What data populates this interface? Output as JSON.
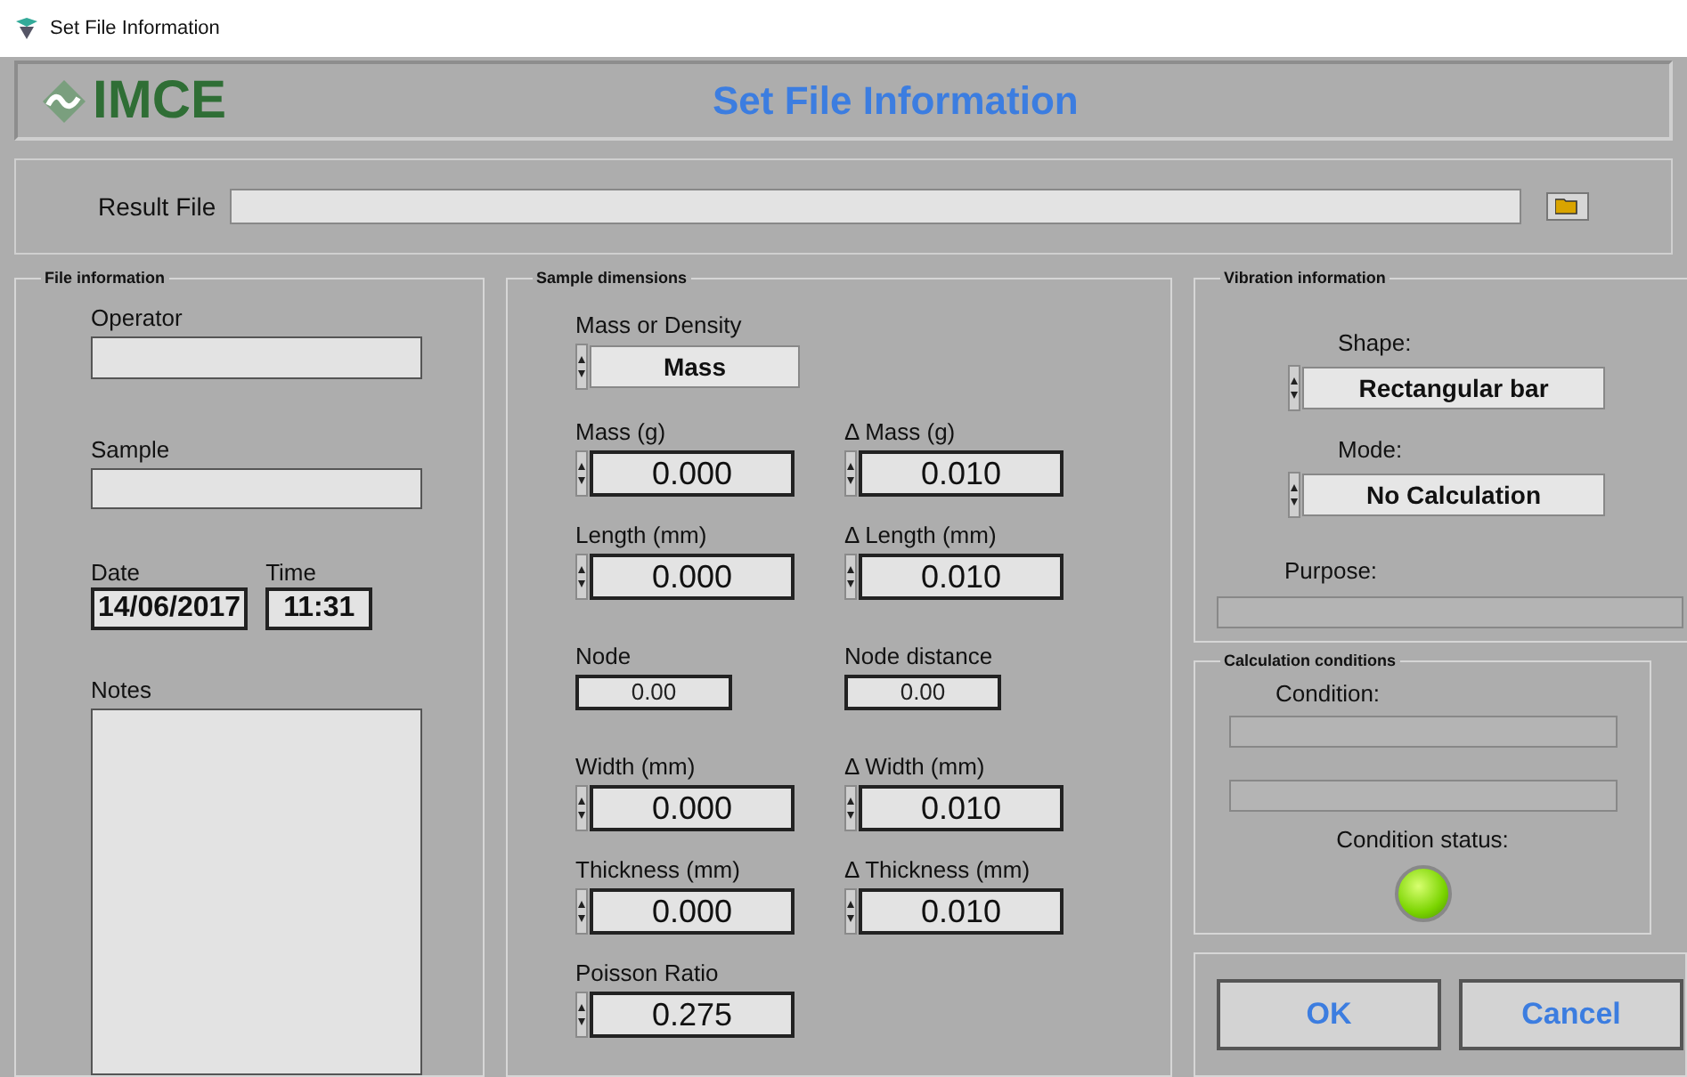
{
  "window": {
    "title": "Set File Information"
  },
  "header": {
    "logo_text": "IMCE",
    "title": "Set File Information"
  },
  "result_file": {
    "label": "Result File"
  },
  "file_information": {
    "title": "File information",
    "operator": {
      "label": "Operator"
    },
    "sample": {
      "label": "Sample"
    },
    "date": {
      "label": "Date",
      "value": "14/06/2017"
    },
    "time": {
      "label": "Time",
      "value": "11:31"
    },
    "notes": {
      "label": "Notes"
    }
  },
  "sample_dimensions": {
    "title": "Sample dimensions",
    "mass_or_density": {
      "label": "Mass or Density",
      "value": "Mass"
    },
    "rows": [
      [
        {
          "kind": "spin",
          "label": "Mass (g)",
          "value": "0.000"
        },
        {
          "kind": "spin",
          "label": "Δ Mass (g)",
          "value": "0.010"
        }
      ],
      [
        {
          "kind": "spin",
          "label": "Length (mm)",
          "value": "0.000"
        },
        {
          "kind": "spin",
          "label": "Δ Length (mm)",
          "value": "0.010"
        }
      ],
      [
        {
          "kind": "indicator",
          "label": "Node",
          "value": "0.00"
        },
        {
          "kind": "indicator",
          "label": "Node distance",
          "value": "0.00"
        }
      ],
      [
        {
          "kind": "spin",
          "label": "Width (mm)",
          "value": "0.000"
        },
        {
          "kind": "spin",
          "label": "Δ Width (mm)",
          "value": "0.010"
        }
      ],
      [
        {
          "kind": "spin",
          "label": "Thickness (mm)",
          "value": "0.000"
        },
        {
          "kind": "spin",
          "label": "Δ Thickness (mm)",
          "value": "0.010"
        }
      ],
      [
        {
          "kind": "spin",
          "label": "Poisson Ratio",
          "value": "0.275"
        }
      ]
    ]
  },
  "vibration_information": {
    "title": "Vibration information",
    "shape": {
      "label": "Shape:",
      "value": "Rectangular bar"
    },
    "mode": {
      "label": "Mode:",
      "value": "No Calculation"
    },
    "purpose": {
      "label": "Purpose:"
    }
  },
  "calculation_conditions": {
    "title": "Calculation conditions",
    "condition": {
      "label": "Condition:"
    },
    "status": {
      "label": "Condition status:",
      "on": true
    }
  },
  "buttons": [
    "OK",
    "Cancel"
  ]
}
